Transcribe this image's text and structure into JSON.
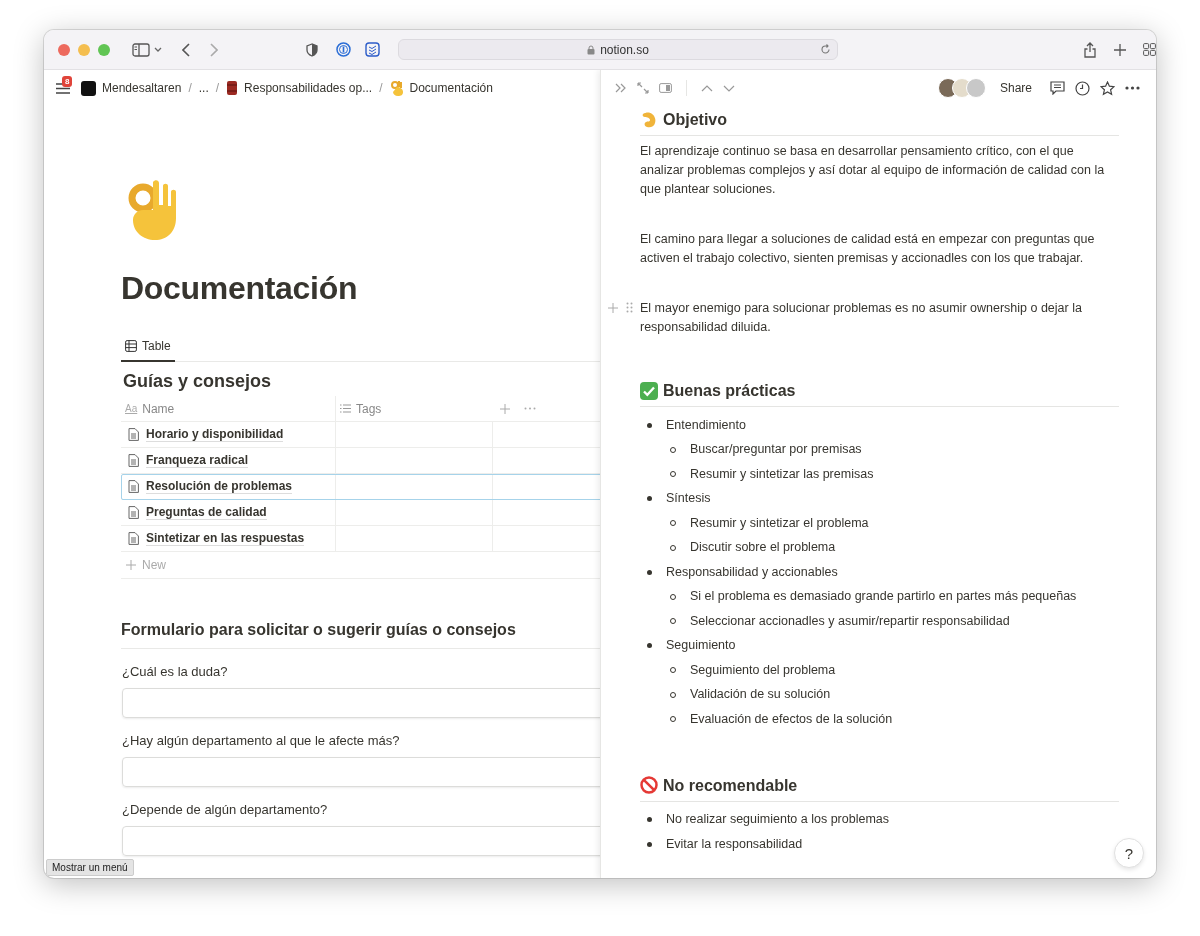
{
  "browser": {
    "url": "notion.so"
  },
  "topbar": {
    "menu_badge": "8",
    "breadcrumbs": [
      {
        "label": "Mendesaltaren"
      },
      {
        "separator": "/",
        "label": "..."
      },
      {
        "separator": "/",
        "label": "Responsabilidades op..."
      },
      {
        "separator": "/",
        "label": "Documentación"
      }
    ]
  },
  "page": {
    "title": "Documentación",
    "view_tabs": [
      {
        "label": "Table",
        "selected": true
      }
    ],
    "database": {
      "title": "Guías y consejos",
      "columns": [
        {
          "label": "Name",
          "kind": "title",
          "type_label": "Aa"
        },
        {
          "label": "Tags",
          "kind": "multi"
        }
      ],
      "rows": [
        {
          "name": "Horario y disponibilidad",
          "selected": false
        },
        {
          "name": "Franqueza radical",
          "selected": false
        },
        {
          "name": "Resolución de problemas",
          "selected": true
        },
        {
          "name": "Preguntas de calidad",
          "selected": false
        },
        {
          "name": "Sintetizar en las respuestas",
          "selected": false
        }
      ],
      "new_label": "New"
    },
    "form": {
      "title": "Formulario para solicitar o sugerir guías o consejos",
      "questions": [
        "¿Cuál es la duda?",
        "¿Hay algún departamento al que le afecte más?",
        "¿Depende de algún departamento?"
      ]
    }
  },
  "tooltip": "Mostrar un menú",
  "peek": {
    "share_label": "Share",
    "sections": [
      {
        "kind": "heading",
        "text": "Objetivo"
      },
      {
        "kind": "paragraph",
        "hovered": false,
        "text": "El aprendizaje continuo se basa en desarrollar pensamiento crítico, con el que analizar problemas complejos y así dotar al equipo de información de calidad con la que plantear soluciones."
      },
      {
        "kind": "paragraph",
        "hovered": false,
        "text": "El camino para llegar a soluciones de calidad está en empezar con preguntas que activen el trabajo colectivo, sienten premisas y accionadles con los que trabajar."
      },
      {
        "kind": "paragraph",
        "hovered": true,
        "text": "El mayor enemigo para solucionar problemas es no asumir ownership o dejar la responsabilidad diluida."
      },
      {
        "kind": "heading",
        "text": "Buenas prácticas"
      },
      {
        "kind": "list",
        "items": [
          {
            "text": "Entendimiento",
            "children": [
              {
                "text": "Buscar/preguntar por premisas"
              },
              {
                "text": "Resumir y sintetizar las premisas"
              }
            ]
          },
          {
            "text": "Síntesis",
            "children": [
              {
                "text": "Resumir y sintetizar el problema"
              },
              {
                "text": "Discutir sobre el problema"
              }
            ]
          },
          {
            "text": "Responsabilidad y accionables",
            "children": [
              {
                "text": "Si el problema es demasiado grande partirlo en partes más pequeñas"
              },
              {
                "text": "Seleccionar accionadles y asumir/repartir responsabilidad"
              }
            ]
          },
          {
            "text": "Seguimiento",
            "children": [
              {
                "text": "Seguimiento del problema"
              },
              {
                "text": "Validación de su solución"
              },
              {
                "text": "Evaluación de efectos de la solución"
              }
            ]
          }
        ]
      },
      {
        "kind": "heading",
        "text": "No recomendable"
      },
      {
        "kind": "list",
        "items": [
          {
            "text": "No realizar seguimiento a los problemas"
          },
          {
            "text": "Evitar la responsabilidad"
          }
        ]
      }
    ]
  },
  "help_label": "?"
}
